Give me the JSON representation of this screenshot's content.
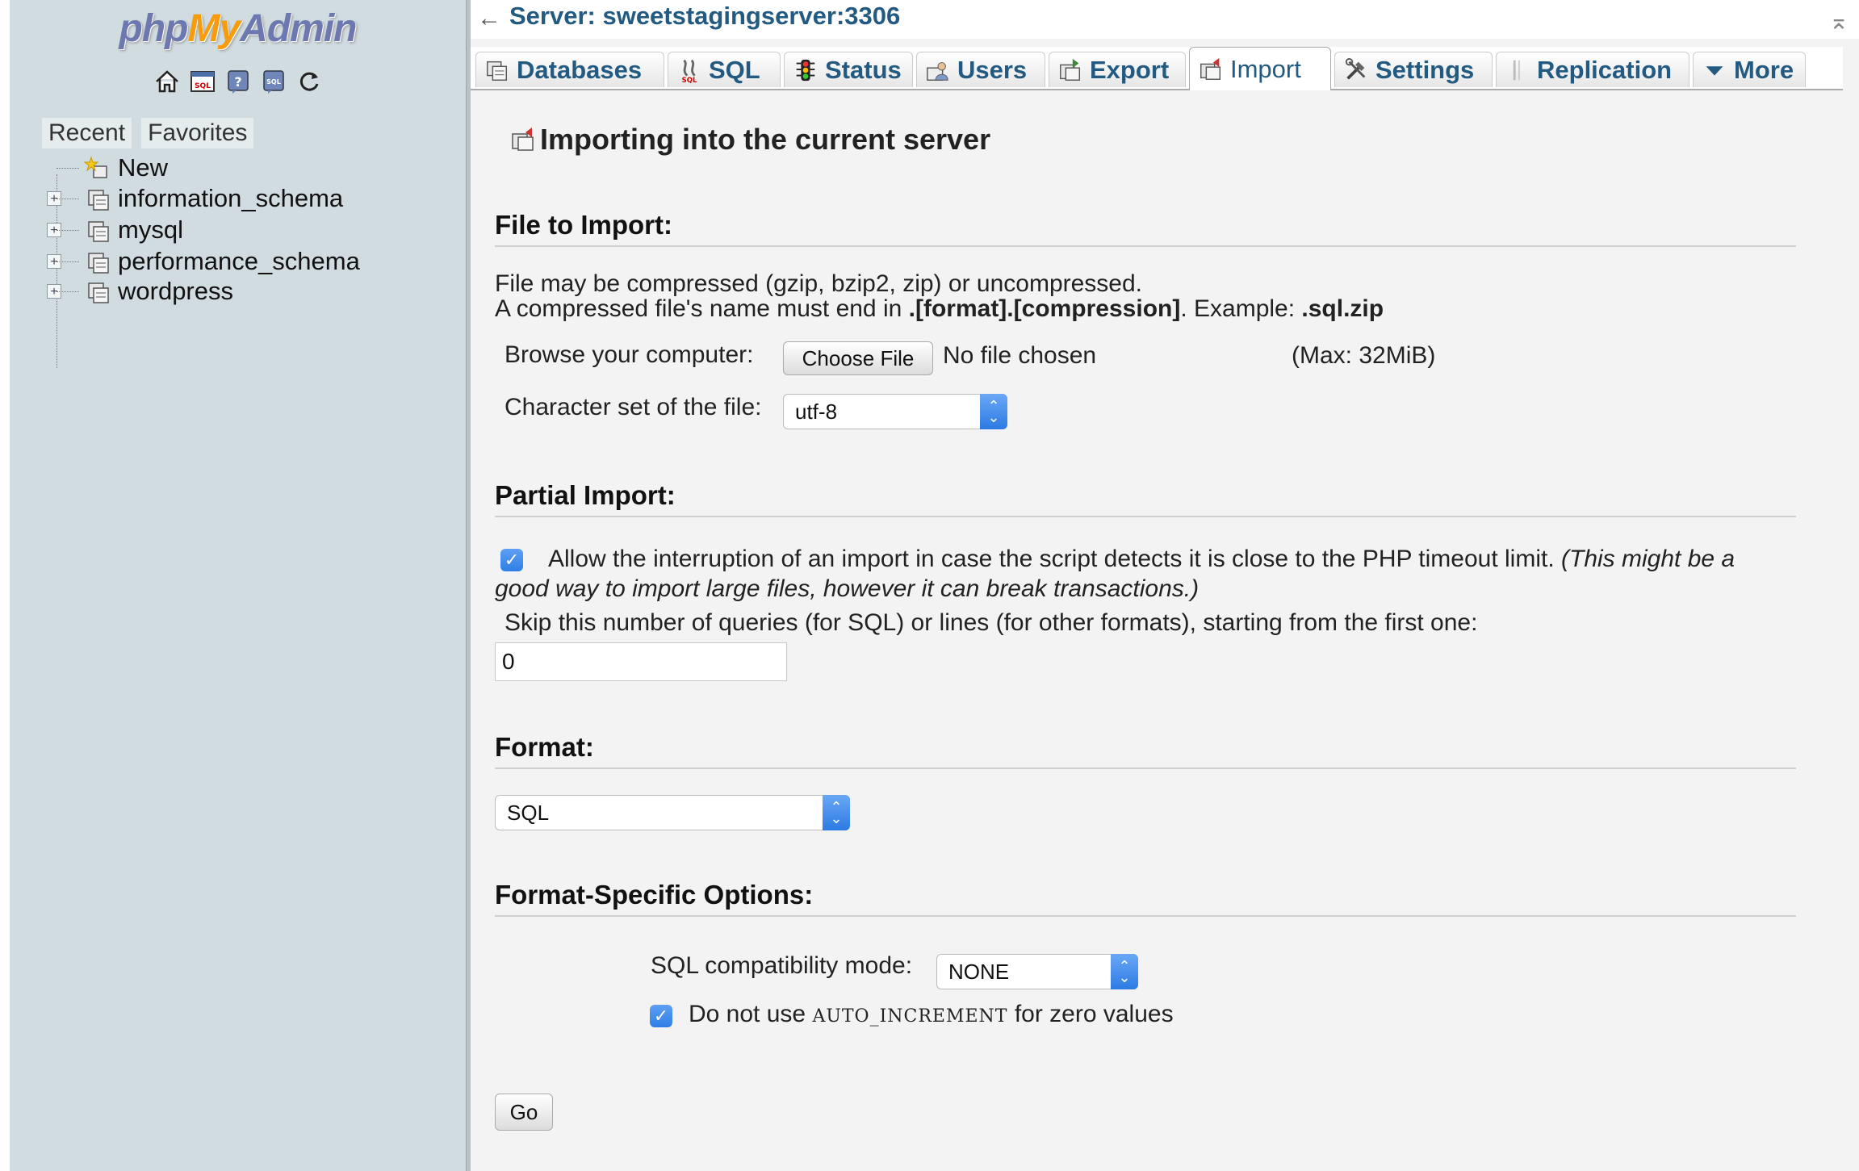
{
  "sidebar": {
    "logo": {
      "php": "php",
      "my": "My",
      "admin": "Admin"
    },
    "quick_icons": [
      "home-icon",
      "sql-query-icon",
      "docs-icon",
      "sql-docs-icon",
      "reload-icon"
    ],
    "nav_tabs": {
      "recent": "Recent",
      "favorites": "Favorites"
    },
    "tree": {
      "new_label": "New",
      "databases": [
        "information_schema",
        "mysql",
        "performance_schema",
        "wordpress"
      ]
    }
  },
  "header": {
    "back_arrow": "←",
    "server_label": "Server: sweetstagingserver:3306",
    "collapse_glyph": "⌅"
  },
  "tabs": [
    {
      "label": "Databases",
      "icon": "database-icon"
    },
    {
      "label": "SQL",
      "icon": "sql-icon"
    },
    {
      "label": "Status",
      "icon": "status-icon"
    },
    {
      "label": "Users",
      "icon": "users-icon"
    },
    {
      "label": "Export",
      "icon": "export-icon"
    },
    {
      "label": "Import",
      "icon": "import-icon",
      "active": true
    },
    {
      "label": "Settings",
      "icon": "settings-icon"
    },
    {
      "label": "Replication",
      "icon": "replication-icon"
    },
    {
      "label": "More",
      "icon": "chevron-down-icon"
    }
  ],
  "page": {
    "title": "Importing into the current server",
    "file_section": {
      "title": "File to Import:",
      "line1": "File may be compressed (gzip, bzip2, zip) or uncompressed.",
      "line2_prefix": "A compressed file's name must end in ",
      "line2_format": ".[format].[compression]",
      "line2_middle": ". Example: ",
      "line2_example": ".sql.zip",
      "browse_label": "Browse your computer:",
      "choose_file_button": "Choose File",
      "no_file_text": "No file chosen",
      "max_size": "(Max: 32MiB)",
      "charset_label": "Character set of the file:",
      "charset_value": "utf-8"
    },
    "partial_section": {
      "title": "Partial Import:",
      "allow_interrupt_checked": true,
      "allow_interrupt_text": "Allow the interruption of an import in case the script detects it is close to the PHP timeout limit.",
      "allow_interrupt_note_1": "(This might be a",
      "allow_interrupt_note_2": "good way to import large files, however it can break transactions.)",
      "skip_label": "Skip this number of queries (for SQL) or lines (for other formats), starting from the first one:",
      "skip_value": "0"
    },
    "format_section": {
      "title": "Format:",
      "format_value": "SQL"
    },
    "format_options": {
      "title": "Format-Specific Options:",
      "compat_label": "SQL compatibility mode:",
      "compat_value": "NONE",
      "no_auto_increment_checked": true,
      "no_auto_increment_prefix": "Do not use ",
      "no_auto_increment_code": "AUTO_INCREMENT",
      "no_auto_increment_suffix": " for zero values"
    },
    "go_button": "Go"
  }
}
